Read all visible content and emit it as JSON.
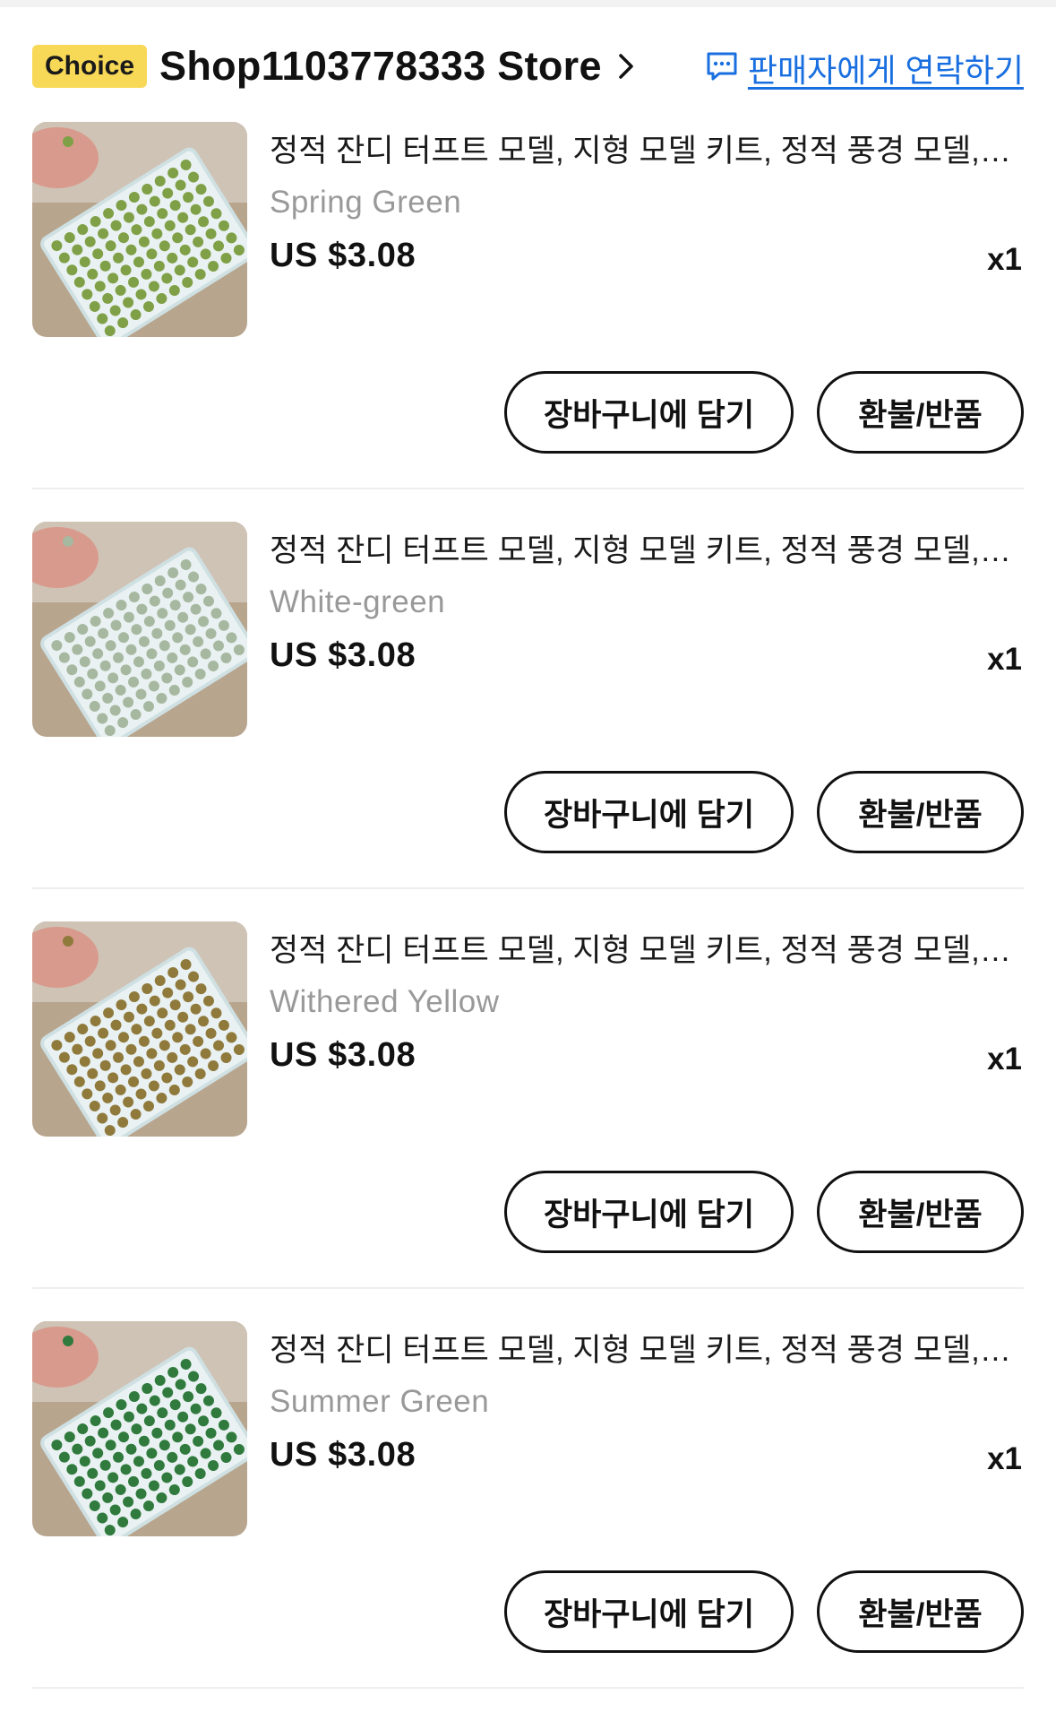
{
  "header": {
    "badge": "Choice",
    "store_name": "Shop1103778333 Store",
    "contact_label": "판매자에게 연락하기"
  },
  "items": [
    {
      "title": "정적 잔디 터프트 모델, 지형 모델 키트, 정적 풍경 모델,…",
      "variant": "Spring Green",
      "price": "US $3.08",
      "qty": "x1",
      "cart_label": "장바구니에 담기",
      "refund_label": "환불/반품",
      "grass_color": "#7fa046"
    },
    {
      "title": "정적 잔디 터프트 모델, 지형 모델 키트, 정적 풍경 모델,…",
      "variant": "White-green",
      "price": "US $3.08",
      "qty": "x1",
      "cart_label": "장바구니에 담기",
      "refund_label": "환불/반품",
      "grass_color": "#a7b8a0"
    },
    {
      "title": "정적 잔디 터프트 모델, 지형 모델 키트, 정적 풍경 모델,…",
      "variant": "Withered Yellow",
      "price": "US $3.08",
      "qty": "x1",
      "cart_label": "장바구니에 담기",
      "refund_label": "환불/반품",
      "grass_color": "#8f7a3c"
    },
    {
      "title": "정적 잔디 터프트 모델, 지형 모델 키트, 정적 풍경 모델,…",
      "variant": "Summer Green",
      "price": "US $3.08",
      "qty": "x1",
      "cart_label": "장바구니에 담기",
      "refund_label": "환불/반품",
      "grass_color": "#2f7a3c"
    }
  ],
  "colors": {
    "accent_link": "#1a6fe0",
    "choice_badge": "#f7d857"
  }
}
